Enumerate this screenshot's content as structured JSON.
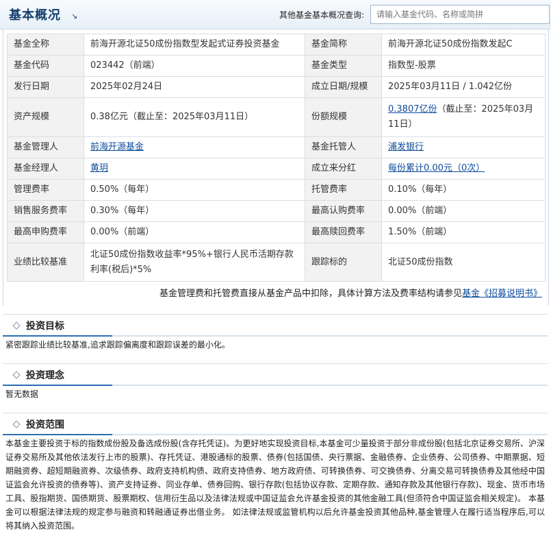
{
  "header": {
    "title": "基本概况",
    "query_label": "其他基金基本概况查询:",
    "search_placeholder": "请输入基金代码、名称或简拼"
  },
  "overview": {
    "rows": [
      {
        "k1": "基金全称",
        "v1": "前海开源北证50成份指数型发起式证券投资基金",
        "k2": "基金简称",
        "v2": "前海开源北证50成份指数发起C"
      },
      {
        "k1": "基金代码",
        "v1": "023442（前端）",
        "k2": "基金类型",
        "v2": "指数型-股票"
      },
      {
        "k1": "发行日期",
        "v1": "2025年02月24日",
        "k2": "成立日期/规模",
        "v2": "2025年03月11日 / 1.042亿份"
      },
      {
        "k1": "资产规模",
        "v1": "0.38亿元（截止至：2025年03月11日）",
        "k2": "份额规模",
        "v2_link": "0.3807亿份",
        "v2": "（截止至：2025年03月11日）"
      },
      {
        "k1": "基金管理人",
        "v1_link": "前海开源基金",
        "k2": "基金托管人",
        "v2_link": "浦发银行"
      },
      {
        "k1": "基金经理人",
        "v1_link": "黄玥",
        "k2": "成立来分红",
        "v2_link": "每份累计0.00元（0次）"
      },
      {
        "k1": "管理费率",
        "v1": "0.50%（每年）",
        "k2": "托管费率",
        "v2": "0.10%（每年）"
      },
      {
        "k1": "销售服务费率",
        "v1": "0.30%（每年）",
        "k2": "最高认购费率",
        "v2": "0.00%（前端）"
      },
      {
        "k1": "最高申购费率",
        "v1": "0.00%（前端）",
        "k2": "最高赎回费率",
        "v2": "1.50%（前端）"
      },
      {
        "k1": "业绩比较基准",
        "v1": "北证50成份指数收益率*95%+银行人民币活期存款利率(税后)*5%",
        "k2": "跟踪标的",
        "v2": "北证50成份指数"
      }
    ],
    "note_text": "基金管理费和托管费直接从基金产品中扣除，具体计算方法及费率结构请参见",
    "note_link": "基金《招募说明书》"
  },
  "sections": {
    "goal": {
      "title": "投资目标",
      "body": "紧密跟踪业绩比较基准,追求跟踪偏离度和跟踪误差的最小化。"
    },
    "idea": {
      "title": "投资理念",
      "body": "暂无数据"
    },
    "scope": {
      "title": "投资范围",
      "body": "本基金主要投资于标的指数成份股及备选成份股(含存托凭证)。为更好地实现投资目标,本基金可少量投资于部分非成份股(包括北京证券交易所、沪深证券交易所及其他依法发行上市的股票)、存托凭证、港股通标的股票、债券(包括国债、央行票据、金融债券、企业债券、公司债券、中期票据、短期融资券、超短期融资券、次级债券、政府支持机构债、政府支持债券、地方政府债、可转换债券、可交换债券、分离交易可转换债券及其他经中国证监会允许投资的债券等)、资产支持证券、同业存单、债券回购、银行存款(包括协议存款、定期存款、通知存款及其他银行存款)、现金、货币市场工具、股指期货、国债期货、股票期权、信用衍生品以及法律法规或中国证监会允许基金投资的其他金融工具(但须符合中国证监会相关规定)。 本基金可以根据法律法规的规定参与融资和转融通证券出借业务。 如法律法规或监管机构以后允许基金投资其他品种,基金管理人在履行适当程序后,可以将其纳入投资范围。"
    }
  }
}
